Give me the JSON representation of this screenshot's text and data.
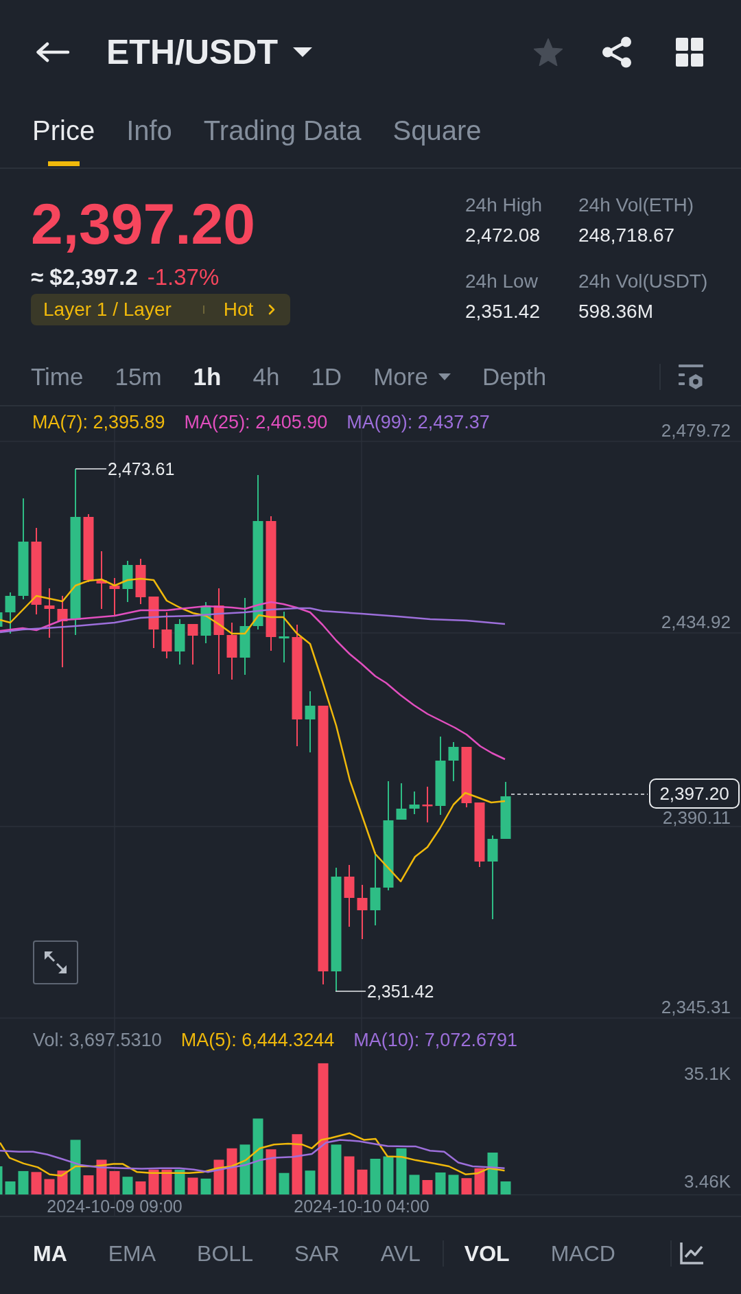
{
  "header": {
    "title": "ETH/USDT",
    "favorite": false
  },
  "tabs": [
    {
      "label": "Price",
      "selected": true
    },
    {
      "label": "Info",
      "selected": false
    },
    {
      "label": "Trading Data",
      "selected": false
    },
    {
      "label": "Square",
      "selected": false
    }
  ],
  "price": {
    "last": "2,397.20",
    "fiat": "≈ $2,397.2",
    "change": "-1.37%",
    "falling": true
  },
  "tag": {
    "category": "Layer 1 / Layer",
    "label": "Hot"
  },
  "stats": [
    {
      "label": "24h High",
      "value": "2,472.08"
    },
    {
      "label": "24h Vol(ETH)",
      "value": "248,718.67"
    },
    {
      "label": "24h Low",
      "value": "2,351.42"
    },
    {
      "label": "24h Vol(USDT)",
      "value": "598.36M"
    }
  ],
  "intervals": [
    {
      "label": "Time",
      "kind": "option",
      "selected": false
    },
    {
      "label": "15m",
      "kind": "option",
      "selected": false
    },
    {
      "label": "1h",
      "kind": "option",
      "selected": true
    },
    {
      "label": "4h",
      "kind": "option",
      "selected": false
    },
    {
      "label": "1D",
      "kind": "option",
      "selected": false
    },
    {
      "label": "More",
      "kind": "dropdown",
      "selected": false
    },
    {
      "label": "Depth",
      "kind": "option",
      "selected": false
    }
  ],
  "chart": {
    "ma_legend": [
      {
        "text": "MA(7): 2,395.89",
        "color": "#f0b90b"
      },
      {
        "text": "MA(25): 2,405.90",
        "color": "#e24fbf"
      },
      {
        "text": "MA(99): 2,437.37",
        "color": "#9d6fdb"
      }
    ],
    "price_axis": [
      "2,479.72",
      "2,434.92",
      "2,390.11",
      "2,345.31"
    ],
    "high_marker": "2,473.61",
    "low_marker": "2,351.42",
    "last_price": "2,397.20"
  },
  "volume": {
    "legend": [
      {
        "text": "Vol: 3,697.5310",
        "color": "#848e9c"
      },
      {
        "text": "MA(5): 6,444.3244",
        "color": "#f0b90b"
      },
      {
        "text": "MA(10): 7,072.6791",
        "color": "#9d6fdb"
      }
    ],
    "axis": [
      "35.1K",
      "3.46K"
    ],
    "time_axis": [
      "2024-10-09 09:00",
      "2024-10-10 04:00"
    ]
  },
  "indicators": {
    "main": [
      {
        "label": "MA",
        "selected": true
      },
      {
        "label": "EMA",
        "selected": false
      },
      {
        "label": "BOLL",
        "selected": false
      },
      {
        "label": "SAR",
        "selected": false
      },
      {
        "label": "AVL",
        "selected": false
      }
    ],
    "sub": [
      {
        "label": "VOL",
        "selected": true
      },
      {
        "label": "MACD",
        "selected": false
      }
    ]
  }
}
